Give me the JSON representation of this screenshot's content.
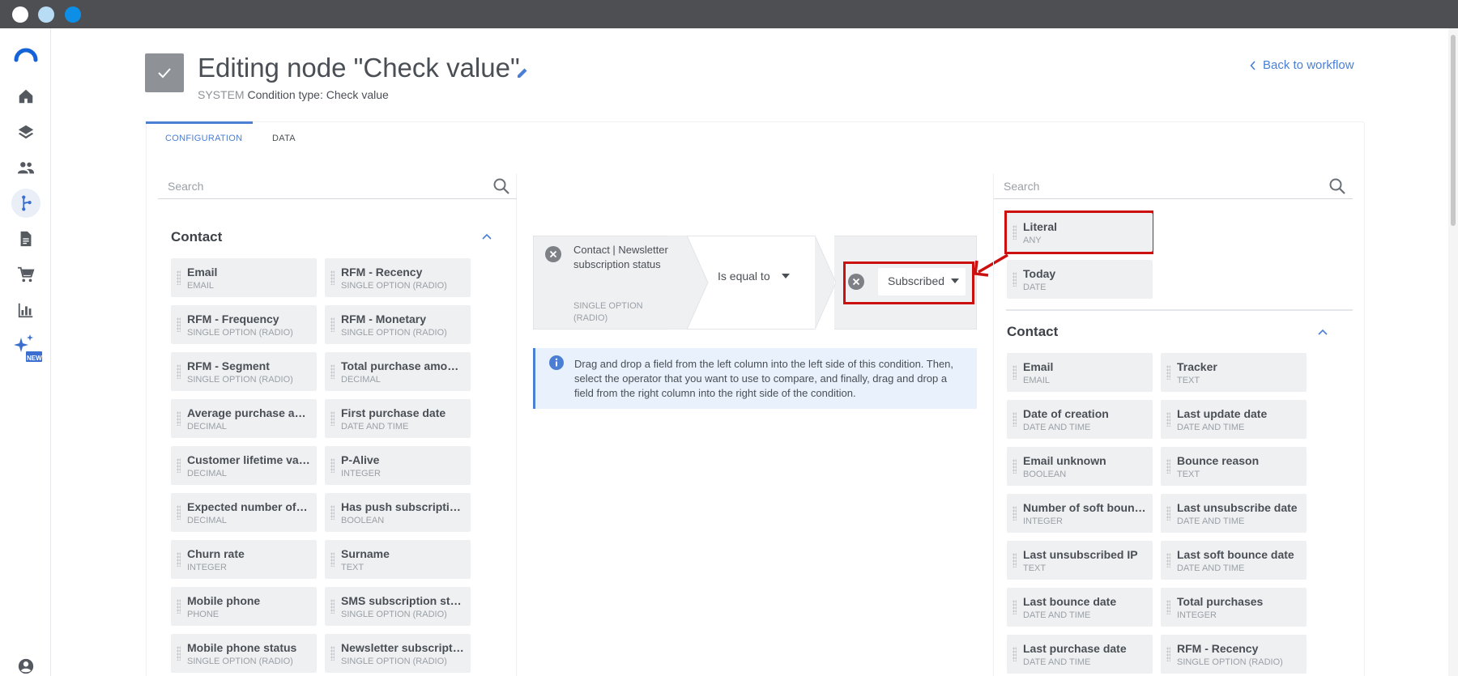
{
  "window": {
    "controls": [
      "close",
      "minimize",
      "maximize"
    ]
  },
  "sidebar": {
    "icons": [
      "logo-icon",
      "home-icon",
      "layers-icon",
      "people-icon",
      "workflow-icon",
      "document-icon",
      "cart-icon",
      "chart-icon",
      "sparkle-new-icon",
      "account-icon"
    ],
    "active": "workflow-icon",
    "new_badge": "NEW"
  },
  "header": {
    "title": "Editing node \"Check value\"",
    "system_label": "SYSTEM",
    "subtitle": "Condition type: Check value",
    "back_link": "Back to workflow"
  },
  "tabs": [
    {
      "label": "CONFIGURATION",
      "active": true
    },
    {
      "label": "DATA",
      "active": false
    }
  ],
  "left_panel": {
    "search_placeholder": "Search",
    "section_title": "Contact",
    "fields": [
      {
        "name": "Email",
        "type": "EMAIL"
      },
      {
        "name": "RFM - Recency",
        "type": "SINGLE OPTION (RADIO)"
      },
      {
        "name": "RFM - Frequency",
        "type": "SINGLE OPTION (RADIO)"
      },
      {
        "name": "RFM - Monetary",
        "type": "SINGLE OPTION (RADIO)"
      },
      {
        "name": "RFM - Segment",
        "type": "SINGLE OPTION (RADIO)"
      },
      {
        "name": "Total purchase amount",
        "type": "DECIMAL"
      },
      {
        "name": "Average purchase amo...",
        "type": "DECIMAL"
      },
      {
        "name": "First purchase date",
        "type": "DATE AND TIME"
      },
      {
        "name": "Customer lifetime valu...",
        "type": "DECIMAL"
      },
      {
        "name": "P-Alive",
        "type": "INTEGER"
      },
      {
        "name": "Expected number of p...",
        "type": "DECIMAL"
      },
      {
        "name": "Has push subscriptions",
        "type": "BOOLEAN"
      },
      {
        "name": "Churn rate",
        "type": "INTEGER"
      },
      {
        "name": "Surname",
        "type": "TEXT"
      },
      {
        "name": "Mobile phone",
        "type": "PHONE"
      },
      {
        "name": "SMS subscription status",
        "type": "SINGLE OPTION (RADIO)"
      },
      {
        "name": "Mobile phone status",
        "type": "SINGLE OPTION (RADIO)"
      },
      {
        "name": "Newsletter subscriptio...",
        "type": "SINGLE OPTION (RADIO)"
      }
    ]
  },
  "condition": {
    "left_field": "Contact | Newsletter subscription status",
    "left_type": "SINGLE OPTION (RADIO)",
    "operator": "Is equal to",
    "right_value": "Subscribed"
  },
  "info": {
    "text": "Drag and drop a field from the left column into the left side of this condition. Then, select the operator that you want to use to compare, and finally, drag and drop a field from the right column into the right side of the condition."
  },
  "right_panel": {
    "search_placeholder": "Search",
    "special_fields": [
      {
        "name": "Literal",
        "type": "ANY"
      },
      {
        "name": "Today",
        "type": "DATE"
      }
    ],
    "section_title": "Contact",
    "fields": [
      {
        "name": "Email",
        "type": "EMAIL"
      },
      {
        "name": "Tracker",
        "type": "TEXT"
      },
      {
        "name": "Date of creation",
        "type": "DATE AND TIME"
      },
      {
        "name": "Last update date",
        "type": "DATE AND TIME"
      },
      {
        "name": "Email unknown",
        "type": "BOOLEAN"
      },
      {
        "name": "Bounce reason",
        "type": "TEXT"
      },
      {
        "name": "Number of soft bounces",
        "type": "INTEGER"
      },
      {
        "name": "Last unsubscribe date",
        "type": "DATE AND TIME"
      },
      {
        "name": "Last unsubscribed IP",
        "type": "TEXT"
      },
      {
        "name": "Last soft bounce date",
        "type": "DATE AND TIME"
      },
      {
        "name": "Last bounce date",
        "type": "DATE AND TIME"
      },
      {
        "name": "Total purchases",
        "type": "INTEGER"
      },
      {
        "name": "Last purchase date",
        "type": "DATE AND TIME"
      },
      {
        "name": "RFM - Recency",
        "type": "SINGLE OPTION (RADIO)"
      }
    ]
  },
  "colors": {
    "accent": "#4a7fd4",
    "highlight": "#cc1010",
    "titlebar": "#4d4f53"
  }
}
